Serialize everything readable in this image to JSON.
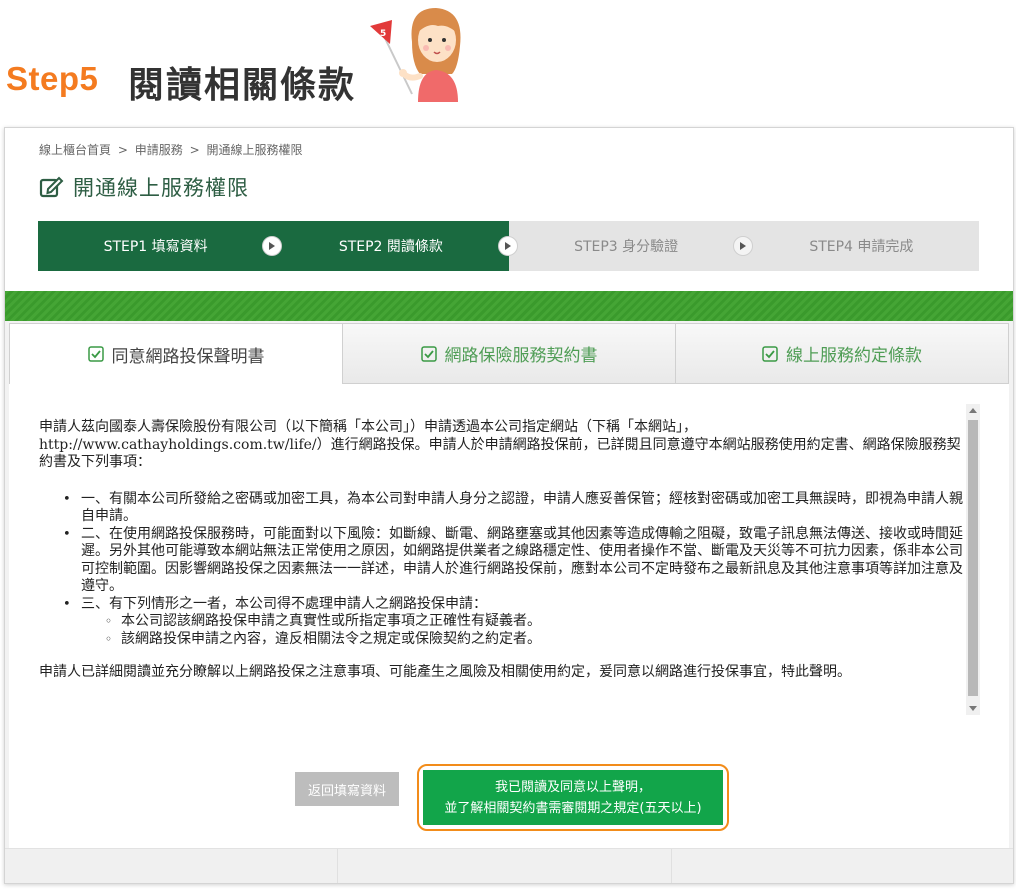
{
  "header": {
    "step_label": "Step5",
    "title": "閱讀相關條款",
    "mascot_flag": "5"
  },
  "breadcrumb": [
    "線上櫃台首頁",
    ">",
    "申請服務",
    ">",
    "開通線上服務權限"
  ],
  "page_title": "開通線上服務權限",
  "progress_steps": [
    {
      "label": "STEP1 填寫資料",
      "state": "active"
    },
    {
      "label": "STEP2 閱讀條款",
      "state": "active"
    },
    {
      "label": "STEP3 身分驗證",
      "state": "inactive"
    },
    {
      "label": "STEP4 申請完成",
      "state": "inactive"
    }
  ],
  "tabs": [
    {
      "label": "同意網路投保聲明書",
      "active": true
    },
    {
      "label": "網路保險服務契約書",
      "active": false
    },
    {
      "label": "線上服務約定條款",
      "active": false
    }
  ],
  "terms": {
    "intro": "申請人茲向國泰人壽保險股份有限公司（以下簡稱「本公司」）申請透過本公司指定網站（下稱「本網站」，http://www.cathayholdings.com.tw/life/）進行網路投保。申請人於申請網路投保前，已詳閱且同意遵守本網站服務使用約定書、網路保險服務契約書及下列事項：",
    "items": [
      "一、有關本公司所發給之密碼或加密工具，為本公司對申請人身分之認證，申請人應妥善保管；經核對密碼或加密工具無誤時，即視為申請人親自申請。",
      "二、在使用網路投保服務時，可能面對以下風險：如斷線、斷電、網路壅塞或其他因素等造成傳輸之阻礙，致電子訊息無法傳送、接收或時間延遲。另外其他可能導致本網站無法正常使用之原因，如網路提供業者之線路穩定性、使用者操作不當、斷電及天災等不可抗力因素，係非本公司可控制範圍。因影響網路投保之因素無法一一詳述，申請人於進行網路投保前，應對本公司不定時發布之最新訊息及其他注意事項等詳加注意及遵守。",
      "三、有下列情形之一者，本公司得不處理申請人之網路投保申請："
    ],
    "sub_items": [
      "本公司認該網路投保申請之真實性或所指定事項之正確性有疑義者。",
      "該網路投保申請之內容，違反相關法令之規定或保險契約之約定者。"
    ],
    "closing": "申請人已詳細閱讀並充分瞭解以上網路投保之注意事項、可能產生之風險及相關使用約定，爰同意以網路進行投保事宜，特此聲明。"
  },
  "buttons": {
    "back": "返回填寫資料",
    "agree_line1": "我已閱讀及同意以上聲明，",
    "agree_line2": "並了解相關契約書需審閱期之規定(五天以上)"
  },
  "colors": {
    "orange": "#f47b20",
    "dark_green": "#1a6a40",
    "bright_green": "#12a54a",
    "tab_green": "#4f9d55",
    "outline_orange": "#f28c1a"
  }
}
